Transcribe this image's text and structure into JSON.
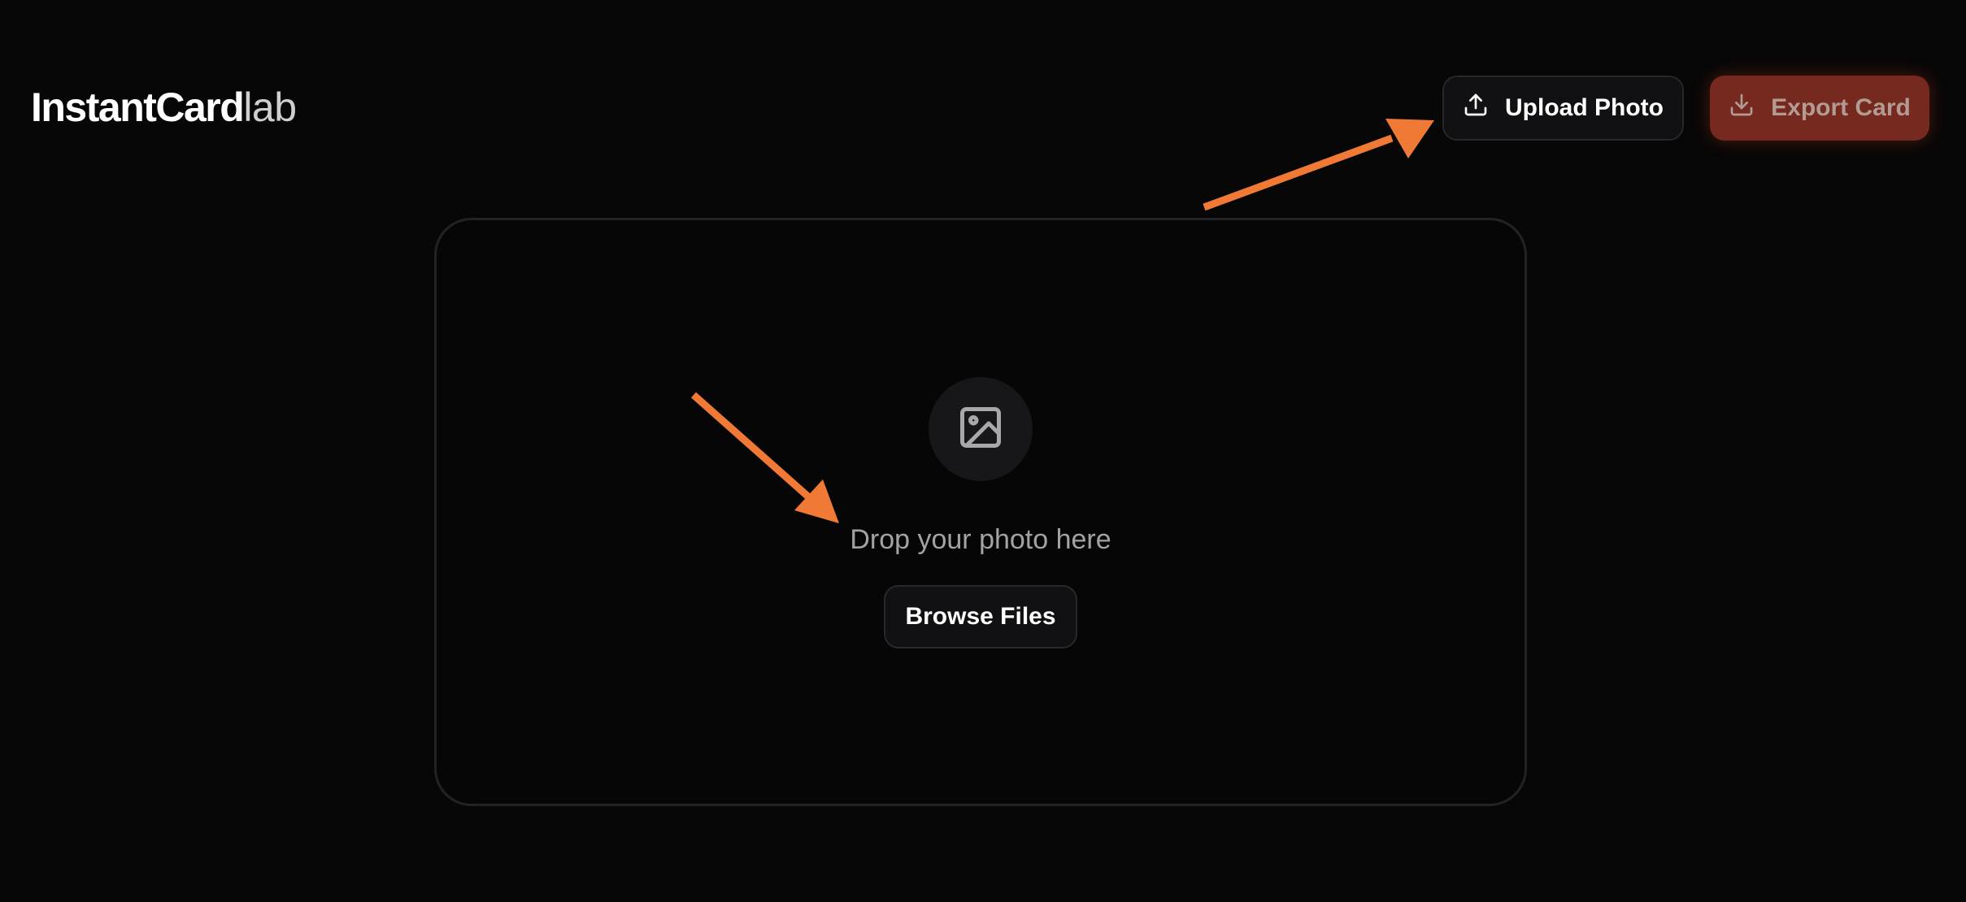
{
  "header": {
    "logo_brand": "InstantCard",
    "logo_suffix": "lab",
    "upload_label": "Upload Photo",
    "export_label": "Export Card"
  },
  "dropzone": {
    "prompt": "Drop your photo here",
    "browse_label": "Browse Files"
  },
  "icons": {
    "upload": "upload-icon",
    "export": "download-icon",
    "placeholder": "image-icon"
  },
  "colors": {
    "background": "#070707",
    "annotation_arrow": "#f07a35",
    "export_button": "#76291f"
  }
}
